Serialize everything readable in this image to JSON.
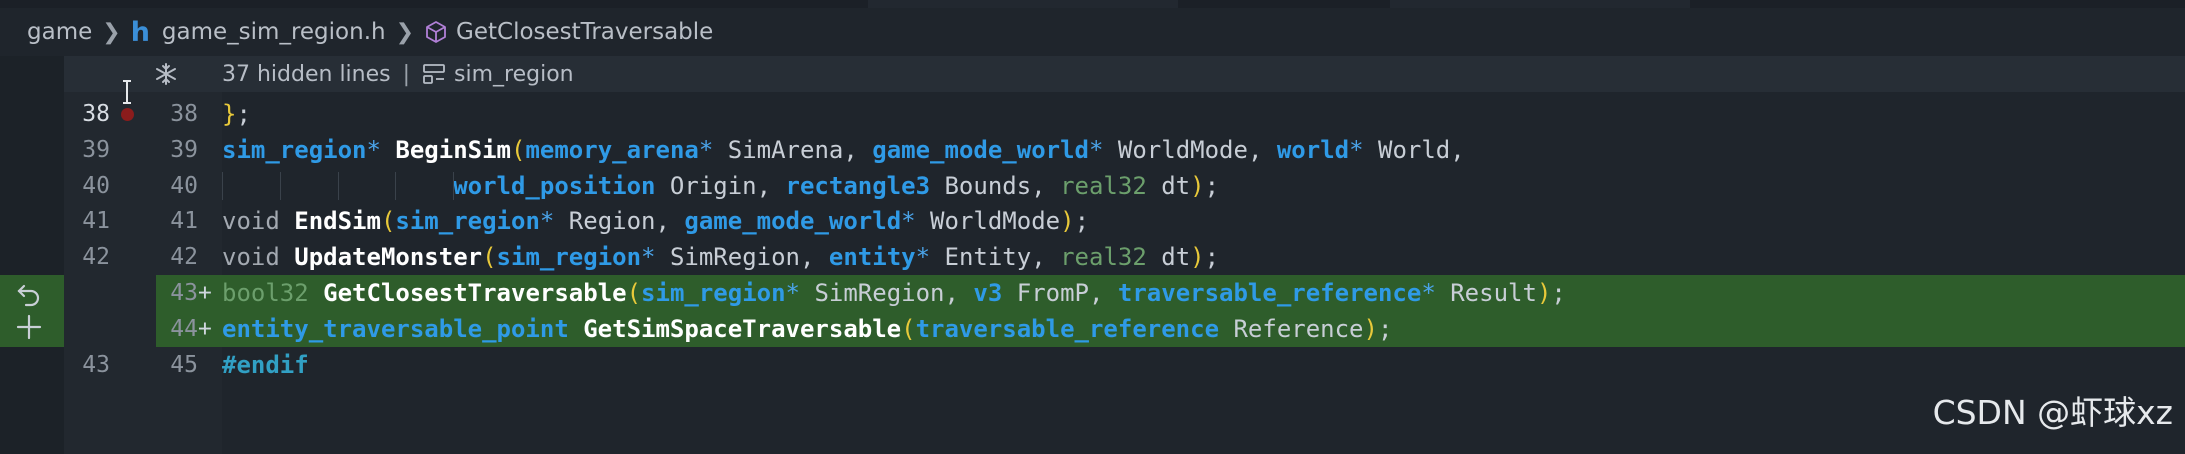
{
  "breadcrumb": {
    "folder": "game",
    "file_icon": "h",
    "file": "game_sim_region.h",
    "symbol": "GetClosestTraversable"
  },
  "hidden_region": {
    "text": "37 hidden lines",
    "separator": "|",
    "namespace": "sim_region"
  },
  "lines": [
    {
      "old": "38",
      "new": "38",
      "added": false,
      "breakpoint": true,
      "active": true,
      "tokens": [
        [
          "paren",
          "}"
        ],
        [
          "punct",
          ";"
        ]
      ]
    },
    {
      "old": "39",
      "new": "39",
      "added": false,
      "tokens": [
        [
          "type",
          "sim_region"
        ],
        [
          "op",
          "*"
        ],
        [
          "punct",
          " "
        ],
        [
          "fn",
          "BeginSim"
        ],
        [
          "paren",
          "("
        ],
        [
          "type",
          "memory_arena"
        ],
        [
          "op",
          "*"
        ],
        [
          "id",
          " SimArena, "
        ],
        [
          "type",
          "game_mode_world"
        ],
        [
          "op",
          "*"
        ],
        [
          "id",
          " WorldMode, "
        ],
        [
          "type",
          "world"
        ],
        [
          "op",
          "*"
        ],
        [
          "id",
          " World,"
        ]
      ]
    },
    {
      "old": "40",
      "new": "40",
      "added": false,
      "indent": 10,
      "tokens": [
        [
          "type",
          "world_position"
        ],
        [
          "id",
          " Origin, "
        ],
        [
          "type",
          "rectangle3"
        ],
        [
          "id",
          " Bounds, "
        ],
        [
          "num",
          "real32"
        ],
        [
          "id",
          " dt"
        ],
        [
          "paren",
          ")"
        ],
        [
          "punct",
          ";"
        ]
      ]
    },
    {
      "old": "41",
      "new": "41",
      "added": false,
      "tokens": [
        [
          "kw",
          "void"
        ],
        [
          "punct",
          " "
        ],
        [
          "fn",
          "EndSim"
        ],
        [
          "paren",
          "("
        ],
        [
          "type",
          "sim_region"
        ],
        [
          "op",
          "*"
        ],
        [
          "id",
          " Region, "
        ],
        [
          "type",
          "game_mode_world"
        ],
        [
          "op",
          "*"
        ],
        [
          "id",
          " WorldMode"
        ],
        [
          "paren",
          ")"
        ],
        [
          "punct",
          ";"
        ]
      ]
    },
    {
      "old": "42",
      "new": "42",
      "added": false,
      "tokens": [
        [
          "kw",
          "void"
        ],
        [
          "punct",
          " "
        ],
        [
          "fn",
          "UpdateMonster"
        ],
        [
          "paren",
          "("
        ],
        [
          "type",
          "sim_region"
        ],
        [
          "op",
          "*"
        ],
        [
          "id",
          " SimRegion, "
        ],
        [
          "type",
          "entity"
        ],
        [
          "op",
          "*"
        ],
        [
          "id",
          " Entity, "
        ],
        [
          "num",
          "real32"
        ],
        [
          "id",
          " dt"
        ],
        [
          "paren",
          ")"
        ],
        [
          "punct",
          ";"
        ]
      ]
    },
    {
      "old": "",
      "new": "43",
      "added": true,
      "tokens": [
        [
          "num",
          "bool32"
        ],
        [
          "punct",
          " "
        ],
        [
          "fn",
          "GetClosestTraversable"
        ],
        [
          "paren",
          "("
        ],
        [
          "type",
          "sim_region"
        ],
        [
          "op",
          "*"
        ],
        [
          "id",
          " SimRegion, "
        ],
        [
          "type",
          "v3"
        ],
        [
          "id",
          " FromP, "
        ],
        [
          "type",
          "traversable_reference"
        ],
        [
          "op",
          "*"
        ],
        [
          "id",
          " Result"
        ],
        [
          "paren",
          ")"
        ],
        [
          "punct",
          ";"
        ]
      ]
    },
    {
      "old": "",
      "new": "44",
      "added": true,
      "tokens": [
        [
          "type",
          "entity_traversable_point"
        ],
        [
          "punct",
          " "
        ],
        [
          "fn",
          "GetSimSpaceTraversable"
        ],
        [
          "paren",
          "("
        ],
        [
          "type",
          "traversable_reference"
        ],
        [
          "id",
          " Reference"
        ],
        [
          "paren",
          ")"
        ],
        [
          "punct",
          ";"
        ]
      ]
    },
    {
      "old": "43",
      "new": "45",
      "added": false,
      "tokens": [
        [
          "pp",
          "#endif"
        ]
      ]
    }
  ],
  "plus_sign": "+",
  "watermark": "CSDN @虾球xz",
  "colors": {
    "background": "#1f252c",
    "added_line": "#2e5d2b",
    "type": "#2f9ae6",
    "function": "#ffffff",
    "paren": "#e8c93a",
    "breakpoint": "#8b1c1c"
  },
  "icons": [
    "chevron-right-icon",
    "header-file-icon",
    "symbol-cube-icon",
    "expand-lines-icon",
    "namespace-icon",
    "text-cursor-icon",
    "breakpoint-dot-icon",
    "undo-icon",
    "add-icon"
  ]
}
